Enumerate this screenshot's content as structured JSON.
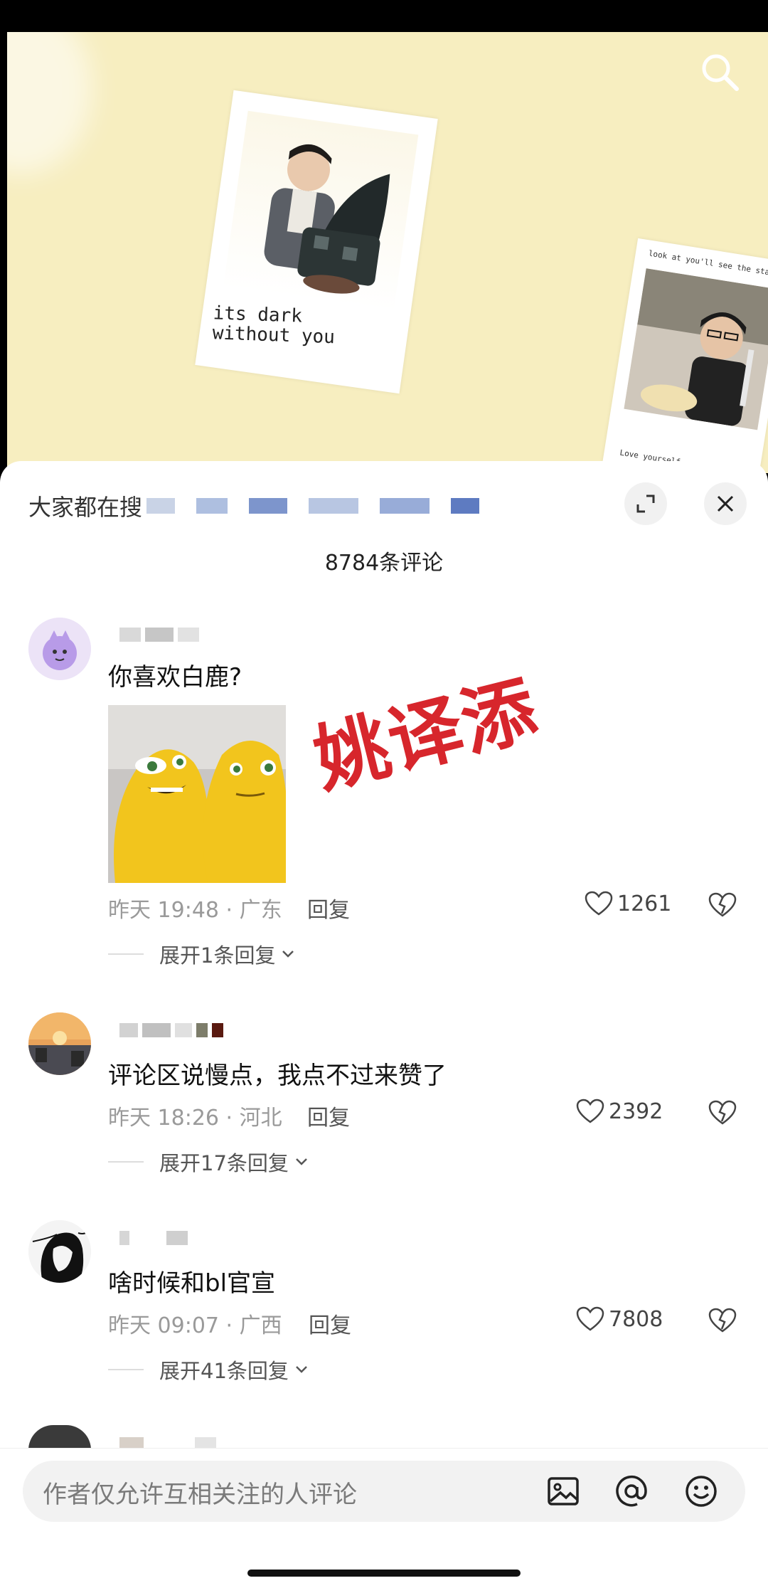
{
  "sheet": {
    "search_hint": "大家都在搜",
    "comment_count": "8784条评论"
  },
  "overlay": {
    "text": "姚译添"
  },
  "comments": [
    {
      "text": "你喜欢白鹿?",
      "meta": "昨天 19:48 · 广东",
      "reply_label": "回复",
      "likes": "1261",
      "expand_label": "展开1条回复"
    },
    {
      "text": "评论区说慢点，我点不过来赞了",
      "meta": "昨天 18:26 · 河北",
      "reply_label": "回复",
      "likes": "2392",
      "expand_label": "展开17条回复"
    },
    {
      "text": "啥时候和bl官宣",
      "meta": "昨天 09:07 · 广西",
      "reply_label": "回复",
      "likes": "7808",
      "expand_label": "展开41条回复"
    }
  ],
  "video": {
    "polaroid_left_caption": "its dark without you",
    "polaroid_right_top": "look at you'll see the stars",
    "polaroid_right_bottom": "Love yourself"
  },
  "input": {
    "placeholder": "作者仅允许互相关注的人评论"
  },
  "colors": {
    "video_bg": "#f7eec0",
    "overlay_red": "#d7262c",
    "sheet_bg": "#ffffff"
  },
  "icons": [
    "search-icon",
    "expand-icon",
    "close-icon",
    "heart-icon",
    "broken-heart-icon",
    "chevron-down-icon",
    "image-icon",
    "at-icon",
    "emoji-icon"
  ]
}
